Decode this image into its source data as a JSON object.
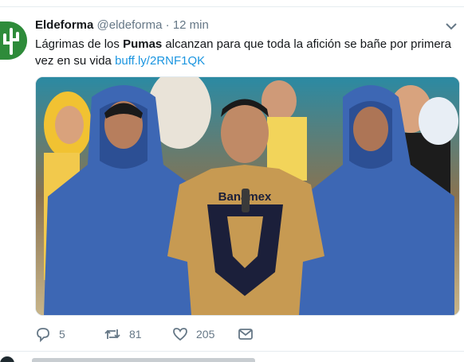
{
  "tweet": {
    "author_name": "Eldeforma",
    "handle": "@eldeforma",
    "dot": "·",
    "time": "12 min",
    "text_parts": {
      "before": "Lágrimas de los ",
      "bold": "Pumas",
      "after": " alcanzan para que toda la afición se bañe por primera vez en su vida ",
      "link": "buff.ly/2RNF1QK"
    },
    "jersey_text": "Banamex",
    "actions": {
      "reply_count": "5",
      "retweet_count": "81",
      "like_count": "205"
    }
  },
  "colors": {
    "link": "#1b95e0",
    "avatar_bg": "#2e8b3a",
    "muted": "#657786",
    "jersey_gold": "#c79a52",
    "poncho_blue": "#3d67b4"
  },
  "icons": [
    "cactus-logo-icon",
    "chevron-down-icon",
    "reply-icon",
    "retweet-icon",
    "like-icon",
    "dm-icon"
  ]
}
